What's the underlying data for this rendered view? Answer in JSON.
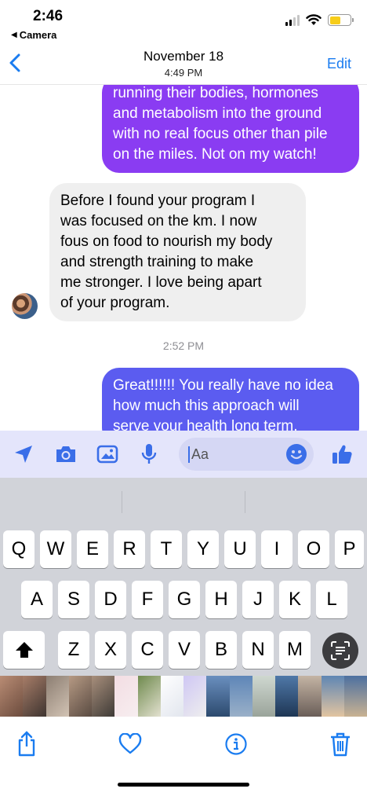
{
  "status_bar": {
    "time": "2:46",
    "back_app": "Camera"
  },
  "header": {
    "title": "November 18",
    "subtitle": "4:49 PM",
    "edit_label": "Edit"
  },
  "messages": [
    {
      "direction": "outgoing",
      "lines": [
        "running their bodies, hormones",
        "and metabolism into the ground",
        "with no real focus other than pile",
        "on the miles. Not on my watch!"
      ]
    },
    {
      "direction": "incoming",
      "lines": [
        "Before I found your program I",
        "was focused on the km. I now",
        "fous on food to nourish my body",
        "and strength training to make",
        "me stronger. I love being apart",
        "of your program."
      ]
    },
    {
      "direction": "outgoing",
      "lines": [
        "Great!!!!!! You really have no idea",
        "how much this approach will",
        "serve your health long term."
      ]
    }
  ],
  "timestamp": "2:52 PM",
  "composer": {
    "placeholder": "Aa",
    "icons": [
      "location-icon",
      "camera-icon",
      "photo-icon",
      "microphone-icon",
      "emoji-icon",
      "thumbs-up-icon"
    ]
  },
  "keyboard": {
    "row1": [
      "Q",
      "W",
      "E",
      "R",
      "T",
      "Y",
      "U",
      "I",
      "O",
      "P"
    ],
    "row2": [
      "A",
      "S",
      "D",
      "F",
      "G",
      "H",
      "J",
      "K",
      "L"
    ],
    "row3": [
      "Z",
      "X",
      "C",
      "V",
      "B",
      "N",
      "M"
    ]
  },
  "colors": {
    "outgoing_top": "#8a3cf2",
    "outgoing_bottom": "#5b5cf0",
    "incoming": "#efefef",
    "accent": "#1a7cf0",
    "composer_icon": "#3a6ee8",
    "battery": "#f7cd1a"
  },
  "toolbar": {
    "icons": [
      "share-icon",
      "heart-icon",
      "info-icon",
      "trash-icon"
    ]
  }
}
